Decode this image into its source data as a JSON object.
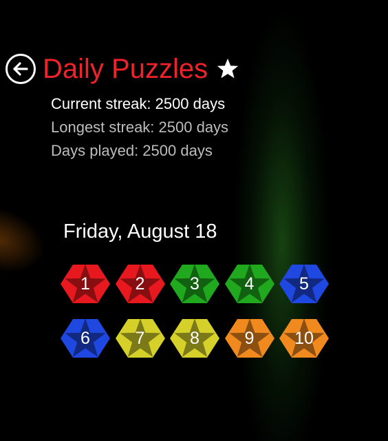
{
  "header": {
    "title": "Daily Puzzles",
    "back_icon": "arrow-left-circle-icon",
    "star_icon": "star-icon"
  },
  "stats": {
    "current": "Current streak: 2500 days",
    "longest": "Longest streak: 2500 days",
    "played": "Days played: 2500 days"
  },
  "date": "Friday, August 18",
  "colors": {
    "title": "#f2222a",
    "red": "#e8191e",
    "green": "#20a81e",
    "blue": "#1f48e0",
    "yellow": "#d6d12a",
    "orange": "#f08a1e"
  },
  "puzzles": [
    {
      "number": "1",
      "color": "red"
    },
    {
      "number": "2",
      "color": "red"
    },
    {
      "number": "3",
      "color": "green"
    },
    {
      "number": "4",
      "color": "green"
    },
    {
      "number": "5",
      "color": "blue"
    },
    {
      "number": "6",
      "color": "blue"
    },
    {
      "number": "7",
      "color": "yellow"
    },
    {
      "number": "8",
      "color": "yellow"
    },
    {
      "number": "9",
      "color": "orange"
    },
    {
      "number": "10",
      "color": "orange"
    }
  ]
}
